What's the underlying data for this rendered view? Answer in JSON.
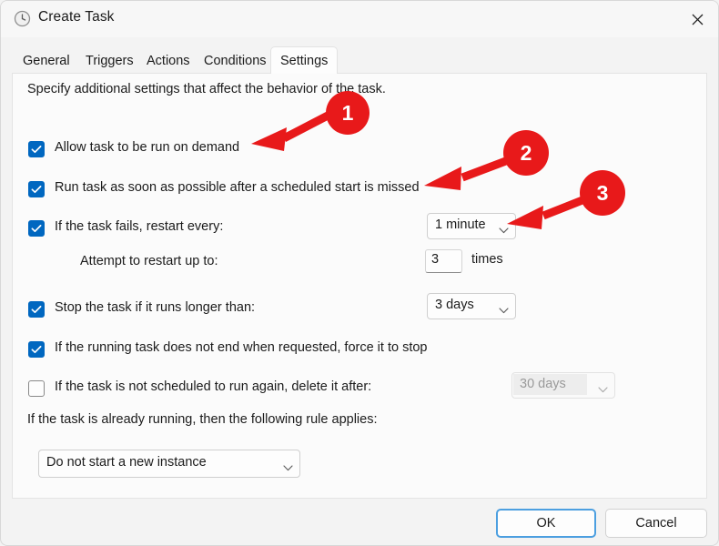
{
  "window": {
    "title": "Create Task",
    "icon": "clock-icon",
    "close_label": "✕"
  },
  "tabs": [
    {
      "label": "General",
      "active": false
    },
    {
      "label": "Triggers",
      "active": false
    },
    {
      "label": "Actions",
      "active": false
    },
    {
      "label": "Conditions",
      "active": false
    },
    {
      "label": "Settings",
      "active": true
    }
  ],
  "content": {
    "intro": "Specify additional settings that affect the behavior of the task.",
    "rows": [
      {
        "id": "allow-run-on-demand",
        "label": "Allow task to be run on demand",
        "checkbox": true,
        "checked": true
      },
      {
        "id": "run-asap-after-missed-start",
        "label": "Run task as soon as possible after a scheduled start is missed",
        "checkbox": true,
        "checked": true
      },
      {
        "id": "restart-on-failure",
        "label": "If the task fails, restart every:",
        "checkbox": true,
        "checked": true
      },
      {
        "id": "attempt-restart-count",
        "label": "Attempt to restart up to:",
        "checkbox": false,
        "checked": false
      },
      {
        "id": "stop-if-runs-longer",
        "label": "Stop the task if it runs longer than:",
        "checkbox": true,
        "checked": true
      },
      {
        "id": "force-stop-if-not-ending",
        "label": "If the running task does not end when requested, force it to stop",
        "checkbox": true,
        "checked": true
      },
      {
        "id": "delete-if-not-rescheduled",
        "label": "If the task is not scheduled to run again, delete it after:",
        "checkbox": true,
        "checked": false
      }
    ],
    "already_running_label": "If the task is already running, then the following rule applies:",
    "restart_interval": {
      "value": "1 minute",
      "disabled": false
    },
    "restart_attempts": {
      "value": "3",
      "unit_label": "times"
    },
    "stop_after": {
      "value": "3 days",
      "disabled": false
    },
    "delete_after": {
      "value": "30 days",
      "disabled": true
    },
    "instance_rule": {
      "value": "Do not start a new instance",
      "disabled": false
    }
  },
  "footer": {
    "ok_label": "OK",
    "cancel_label": "Cancel"
  },
  "annotations": {
    "badges": [
      {
        "number": "1"
      },
      {
        "number": "2"
      },
      {
        "number": "3"
      }
    ],
    "color": "#e8191a"
  }
}
